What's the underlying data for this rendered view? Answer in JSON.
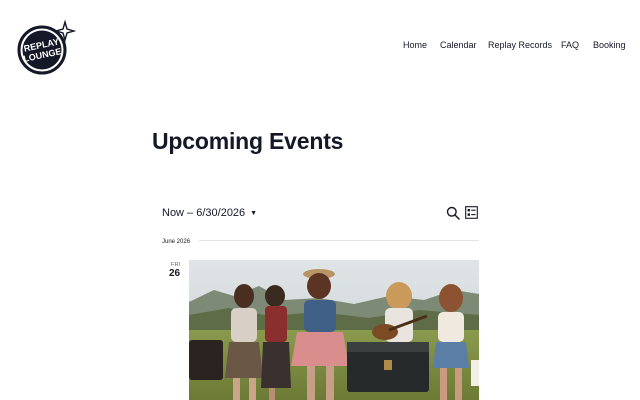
{
  "brand": {
    "logo_text_line1": "REPLAY",
    "logo_text_line2": "LOUNGE"
  },
  "nav": {
    "items": [
      {
        "label": "Home"
      },
      {
        "label": "Calendar"
      },
      {
        "label": "Replay Records"
      },
      {
        "label": "FAQ"
      },
      {
        "label": "Booking"
      }
    ]
  },
  "page": {
    "title": "Upcoming Events"
  },
  "events_bar": {
    "date_range": "Now – 6/30/2026",
    "search_icon": "search-icon",
    "view_icon": "list-view-icon"
  },
  "schedule": {
    "month_label": "June 2026",
    "days": [
      {
        "dow": "FRI",
        "day": "26"
      }
    ]
  },
  "colors": {
    "text": "#141827",
    "divider": "#e4e4e7"
  }
}
